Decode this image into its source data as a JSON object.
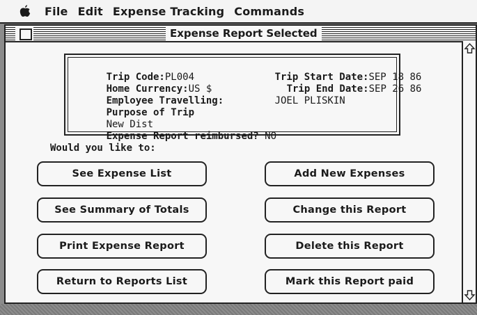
{
  "menubar": {
    "apple_icon": "apple-icon",
    "items": [
      "File",
      "Edit",
      "Expense Tracking",
      "Commands"
    ]
  },
  "window": {
    "title": "Expense Report Selected"
  },
  "report": {
    "trip_code_label": "Trip Code:",
    "trip_code": "PL004",
    "trip_start_label": "Trip Start Date:",
    "trip_start": "SEP 18 86",
    "home_currency_label": "Home Currency:",
    "home_currency": "US $",
    "trip_end_label": "Trip End Date:",
    "trip_end": "SEP 26 86",
    "employee_label": "Employee Travelling:",
    "employee": "JOEL PLISKIN",
    "purpose_label": "Purpose of Trip",
    "purpose": "New Dist",
    "reimbursed_label": "Expense Report reimbursed?",
    "reimbursed": "NO"
  },
  "prompt": "Would you like to:",
  "buttons": {
    "see_expense_list": "See Expense List",
    "add_new_expenses": "Add New Expenses",
    "see_summary": "See Summary of Totals",
    "change_report": "Change this Report",
    "print_report": "Print Expense Report",
    "delete_report": "Delete this Report",
    "return_to_list": "Return to Reports List",
    "mark_paid": "Mark this Report paid"
  }
}
